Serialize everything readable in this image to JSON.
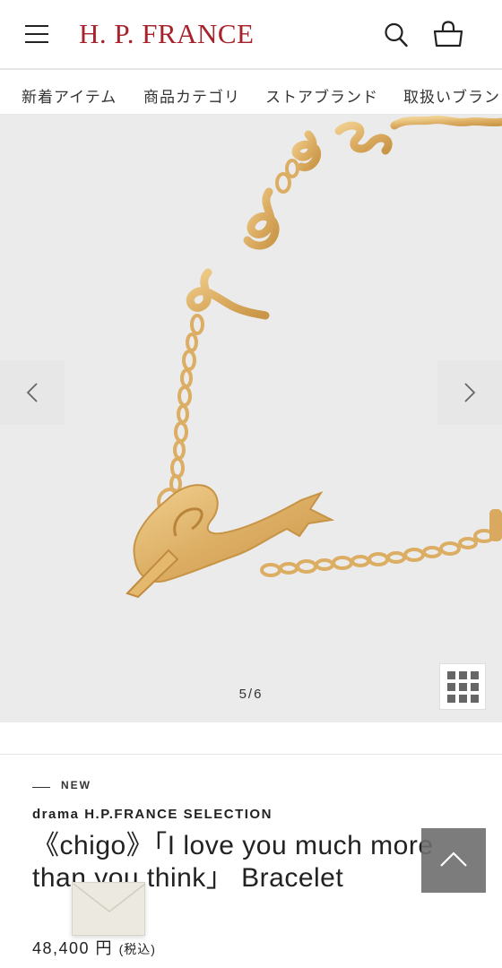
{
  "header": {
    "logo": "H. P. FRANCE",
    "menu_icon": "hamburger-menu-icon",
    "search_icon": "search-icon",
    "cart_icon": "shopping-bag-icon",
    "brand_color": "#a8212b"
  },
  "nav": {
    "items": [
      {
        "label": "新着アイテム"
      },
      {
        "label": "商品カテゴリ"
      },
      {
        "label": "ストアブランド"
      },
      {
        "label": "取扱いブランド"
      }
    ]
  },
  "gallery": {
    "counter": "5/6",
    "prev_icon": "chevron-left-icon",
    "next_icon": "chevron-right-icon",
    "grid_icon": "grid-view-icon",
    "background": "#ebebeb"
  },
  "product": {
    "badge": "NEW",
    "brand": "drama H.P.FRANCE SELECTION",
    "title": "《chigo》「I love you much more than you think」 Bracelet",
    "price": "48,400 円",
    "tax_note": "(税込)"
  },
  "floating": {
    "scroll_top_icon": "chevron-up-icon",
    "mail_icon": "envelope-icon"
  }
}
